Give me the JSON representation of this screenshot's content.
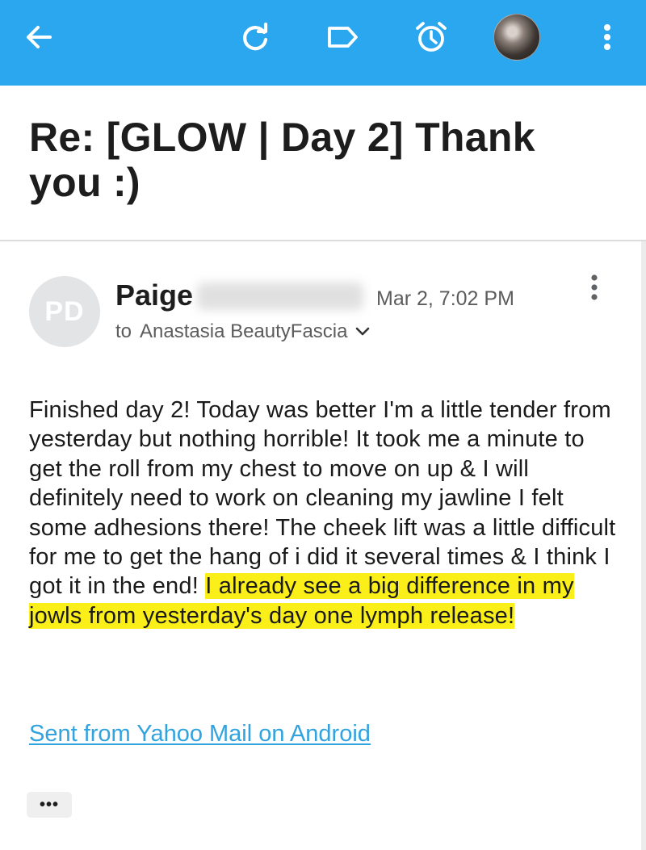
{
  "toolbar": {
    "background": "#2aa7ee",
    "icons": [
      "back-arrow-icon",
      "refresh-icon",
      "label-icon",
      "alarm-icon",
      "profile-photo",
      "more-vert-icon"
    ]
  },
  "message": {
    "subject": "Re: [GLOW | Day 2] Thank you :)",
    "sender": {
      "initials": "PD",
      "first_name": "Paige",
      "date": "Mar 2, 7:02 PM",
      "to_label": "to",
      "recipient": "Anastasia BeautyFascia"
    },
    "body": {
      "text": "Finished day 2! Today was better I'm a little tender from yesterday but nothing horrible! It took me a minute to get the roll from my chest to move on up & I will definitely need to work on cleaning my jawline I felt some adhesions there! The cheek lift was a little difficult for me to get the hang of i did it several times & I think I got it in the end! ",
      "highlighted": "I already see a big difference in my jowls from yesterday's day one lymph release!",
      "highlight_color": "#fbef1a"
    },
    "signature_link": "Sent from Yahoo Mail on Android",
    "link_color": "#31a3de",
    "quoted_toggle": "•••"
  }
}
